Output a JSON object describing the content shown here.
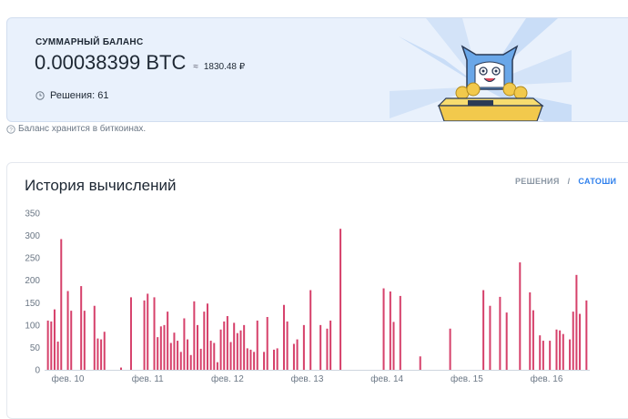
{
  "balance": {
    "label": "СУММАРНЫЙ БАЛАНС",
    "btc": "0.00038399 BTC",
    "approx": "≈",
    "rub": "1830.48 ₽",
    "solutions": "Решения: 61"
  },
  "note": "Баланс хранится в биткоинах.",
  "history": {
    "title": "История вычислений",
    "toggle_solutions": "РЕШЕНИЯ",
    "toggle_separator": "/",
    "toggle_satoshi": "САТОШИ"
  },
  "icons": {
    "clock": "clock-icon",
    "question": "question-circle-icon",
    "mascot": "cat-in-box-illustration"
  },
  "colors": {
    "bar": "#d6416b",
    "card_bg": "#e9f1fc",
    "accent": "#2f80ed"
  },
  "chart_data": {
    "type": "bar",
    "title": "",
    "xlabel": "",
    "ylabel": "",
    "ylim": [
      0,
      350
    ],
    "yticks": [
      0,
      50,
      100,
      150,
      200,
      250,
      300,
      350
    ],
    "x_tick_labels": [
      {
        "label": "фев. 10",
        "x": 4
      },
      {
        "label": "фев. 11",
        "x": 28
      },
      {
        "label": "фев. 12",
        "x": 52
      },
      {
        "label": "фев. 13",
        "x": 76
      },
      {
        "label": "фев. 14",
        "x": 100
      },
      {
        "label": "фев. 15",
        "x": 124
      },
      {
        "label": "фев. 16",
        "x": 148
      }
    ],
    "x_range": [
      -3,
      161
    ],
    "bars": [
      {
        "x": -2,
        "v": 110
      },
      {
        "x": -1,
        "v": 108
      },
      {
        "x": 0,
        "v": 135
      },
      {
        "x": 1,
        "v": 63
      },
      {
        "x": 2,
        "v": 292
      },
      {
        "x": 4,
        "v": 176
      },
      {
        "x": 5,
        "v": 132
      },
      {
        "x": 8,
        "v": 187
      },
      {
        "x": 9,
        "v": 132
      },
      {
        "x": 12,
        "v": 143
      },
      {
        "x": 13,
        "v": 70
      },
      {
        "x": 14,
        "v": 68
      },
      {
        "x": 15,
        "v": 85
      },
      {
        "x": 20,
        "v": 5
      },
      {
        "x": 23,
        "v": 162
      },
      {
        "x": 27,
        "v": 155
      },
      {
        "x": 28,
        "v": 170
      },
      {
        "x": 30,
        "v": 162
      },
      {
        "x": 31,
        "v": 73
      },
      {
        "x": 32,
        "v": 97
      },
      {
        "x": 33,
        "v": 100
      },
      {
        "x": 34,
        "v": 130
      },
      {
        "x": 35,
        "v": 60
      },
      {
        "x": 36,
        "v": 83
      },
      {
        "x": 37,
        "v": 65
      },
      {
        "x": 38,
        "v": 40
      },
      {
        "x": 39,
        "v": 115
      },
      {
        "x": 40,
        "v": 68
      },
      {
        "x": 41,
        "v": 33
      },
      {
        "x": 42,
        "v": 153
      },
      {
        "x": 43,
        "v": 100
      },
      {
        "x": 44,
        "v": 47
      },
      {
        "x": 45,
        "v": 130
      },
      {
        "x": 46,
        "v": 148
      },
      {
        "x": 47,
        "v": 65
      },
      {
        "x": 48,
        "v": 60
      },
      {
        "x": 49,
        "v": 17
      },
      {
        "x": 50,
        "v": 90
      },
      {
        "x": 51,
        "v": 108
      },
      {
        "x": 52,
        "v": 120
      },
      {
        "x": 53,
        "v": 62
      },
      {
        "x": 54,
        "v": 105
      },
      {
        "x": 55,
        "v": 82
      },
      {
        "x": 56,
        "v": 88
      },
      {
        "x": 57,
        "v": 100
      },
      {
        "x": 58,
        "v": 48
      },
      {
        "x": 59,
        "v": 45
      },
      {
        "x": 60,
        "v": 40
      },
      {
        "x": 61,
        "v": 110
      },
      {
        "x": 63,
        "v": 40
      },
      {
        "x": 64,
        "v": 118
      },
      {
        "x": 66,
        "v": 45
      },
      {
        "x": 67,
        "v": 48
      },
      {
        "x": 69,
        "v": 145
      },
      {
        "x": 70,
        "v": 108
      },
      {
        "x": 72,
        "v": 58
      },
      {
        "x": 73,
        "v": 68
      },
      {
        "x": 75,
        "v": 100
      },
      {
        "x": 77,
        "v": 178
      },
      {
        "x": 80,
        "v": 100
      },
      {
        "x": 82,
        "v": 92
      },
      {
        "x": 83,
        "v": 110
      },
      {
        "x": 86,
        "v": 315
      },
      {
        "x": 99,
        "v": 182
      },
      {
        "x": 101,
        "v": 175
      },
      {
        "x": 102,
        "v": 107
      },
      {
        "x": 104,
        "v": 165
      },
      {
        "x": 110,
        "v": 30
      },
      {
        "x": 119,
        "v": 92
      },
      {
        "x": 129,
        "v": 178
      },
      {
        "x": 131,
        "v": 143
      },
      {
        "x": 134,
        "v": 163
      },
      {
        "x": 136,
        "v": 128
      },
      {
        "x": 140,
        "v": 240
      },
      {
        "x": 143,
        "v": 173
      },
      {
        "x": 144,
        "v": 133
      },
      {
        "x": 146,
        "v": 77
      },
      {
        "x": 147,
        "v": 65
      },
      {
        "x": 149,
        "v": 65
      },
      {
        "x": 151,
        "v": 90
      },
      {
        "x": 152,
        "v": 88
      },
      {
        "x": 153,
        "v": 80
      },
      {
        "x": 155,
        "v": 68
      },
      {
        "x": 156,
        "v": 130
      },
      {
        "x": 157,
        "v": 212
      },
      {
        "x": 158,
        "v": 125
      },
      {
        "x": 160,
        "v": 155
      }
    ]
  }
}
